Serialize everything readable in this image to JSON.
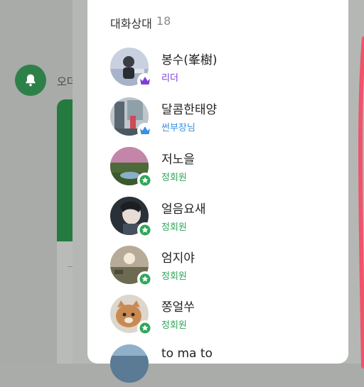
{
  "background": {
    "label": "오더",
    "accent": "#2e8049"
  },
  "header": {
    "title": "대화상대",
    "count": "18"
  },
  "members": [
    {
      "name": "봉수(峯樹)",
      "role": "리더",
      "role_type": "leader",
      "badge": "crown-icon"
    },
    {
      "name": "달콤한태양",
      "role": "썬부장님",
      "role_type": "sub",
      "badge": "crown-icon"
    },
    {
      "name": "저노을",
      "role": "정회원",
      "role_type": "reg",
      "badge": "star-icon"
    },
    {
      "name": "얼음요새",
      "role": "정회원",
      "role_type": "reg",
      "badge": "star-icon"
    },
    {
      "name": "엄지야",
      "role": "정회원",
      "role_type": "reg",
      "badge": "star-icon"
    },
    {
      "name": "쫑얼쑤",
      "role": "정회원",
      "role_type": "reg",
      "badge": "star-icon"
    },
    {
      "name": "to ma to",
      "role": "",
      "role_type": "reg",
      "badge": ""
    }
  ],
  "colors": {
    "leader": "#7e3fd6",
    "sub": "#3a8fe0",
    "regular": "#2fa659",
    "annotation": "#f0546a"
  }
}
